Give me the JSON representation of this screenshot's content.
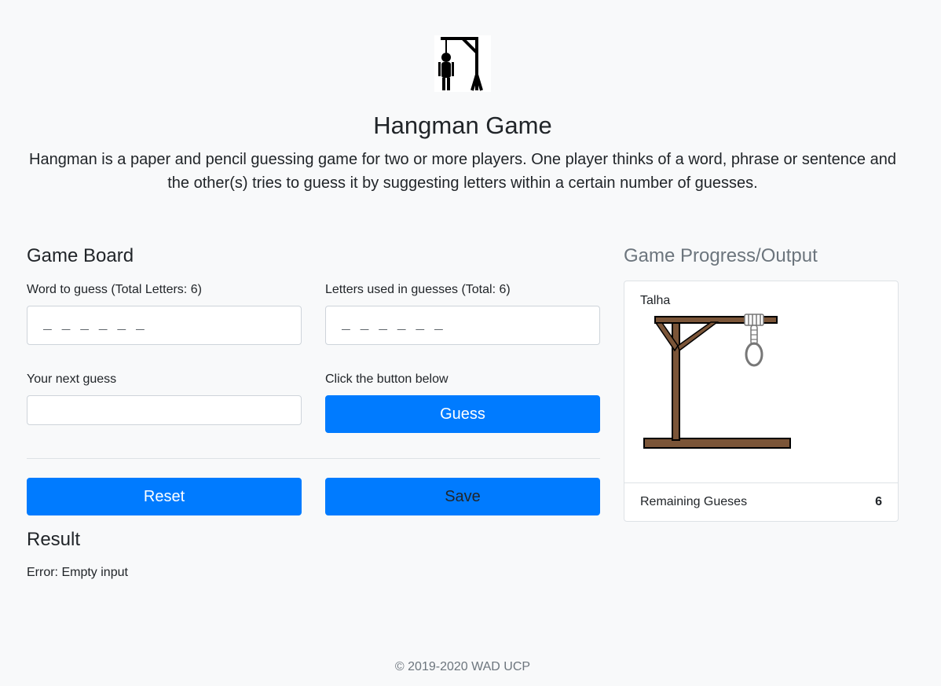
{
  "header": {
    "title": "Hangman Game",
    "description": "Hangman is a paper and pencil guessing game for two or more players. One player thinks of a word, phrase or sentence and the other(s) tries to guess it by suggesting letters within a certain number of guesses."
  },
  "board": {
    "title": "Game Board",
    "word_label": "Word to guess (Total Letters: 6)",
    "word_value": "_ _ _ _ _ _",
    "letters_label": "Letters used in guesses (Total: 6)",
    "letters_value": "_ _ _ _ _ _",
    "guess_label": "Your next guess",
    "guess_value": "",
    "button_hint": "Click the button below",
    "guess_button": "Guess",
    "reset_button": "Reset",
    "save_button": "Save"
  },
  "result": {
    "title": "Result",
    "message": "Error: Empty input"
  },
  "progress": {
    "title": "Game Progress/Output",
    "player": "Talha",
    "remaining_label": "Remaining Gueses",
    "remaining_count": "6"
  },
  "footer": {
    "copyright": "© 2019-2020 WAD UCP"
  },
  "colors": {
    "primary": "#007bff",
    "background": "#f8f9fa",
    "wood": "#7b5538"
  },
  "icons": {
    "logo": "hangman-logo-icon",
    "gallows": "gallows-icon"
  }
}
